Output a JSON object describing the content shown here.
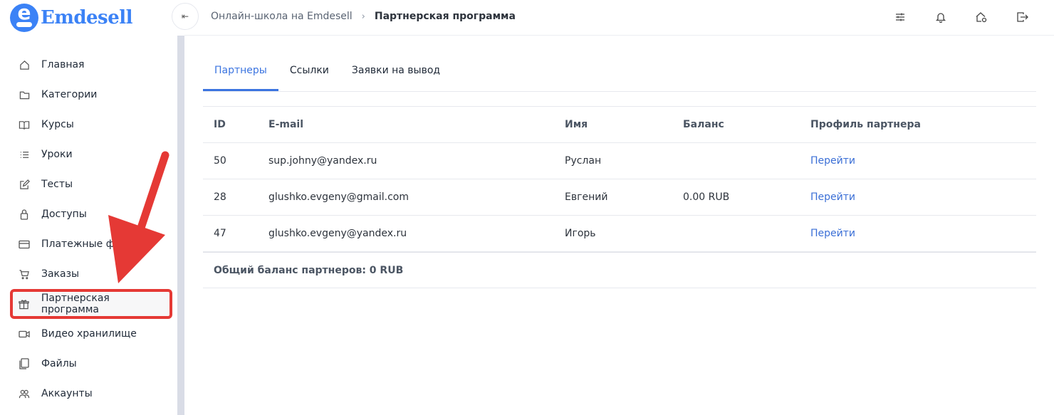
{
  "brand": {
    "name": "Emdesell",
    "mark": "e",
    "color": "#3b82f6"
  },
  "sidebar": {
    "items": [
      {
        "label": "Главная",
        "icon": "home-icon"
      },
      {
        "label": "Категории",
        "icon": "folder-icon"
      },
      {
        "label": "Курсы",
        "icon": "book-icon"
      },
      {
        "label": "Уроки",
        "icon": "list-icon"
      },
      {
        "label": "Тесты",
        "icon": "edit-icon"
      },
      {
        "label": "Доступы",
        "icon": "lock-icon"
      },
      {
        "label": "Платежные фо",
        "icon": "card-icon"
      },
      {
        "label": "Заказы",
        "icon": "cart-icon"
      },
      {
        "label": "Партнерская программа",
        "icon": "gift-icon",
        "active": true
      },
      {
        "label": "Видео хранилище",
        "icon": "video-icon"
      },
      {
        "label": "Файлы",
        "icon": "file-icon"
      },
      {
        "label": "Аккаунты",
        "icon": "users-icon"
      }
    ]
  },
  "header": {
    "collapse_glyph": "⇤",
    "breadcrumb": {
      "parent": "Онлайн-школа на Emdesell",
      "separator": "›",
      "current": "Партнерская программа"
    },
    "icons": [
      "sliders-icon",
      "bell-icon",
      "home-settings-icon",
      "logout-icon"
    ]
  },
  "tabs": [
    {
      "label": "Партнеры",
      "active": true
    },
    {
      "label": "Ссылки"
    },
    {
      "label": "Заявки на вывод"
    }
  ],
  "table": {
    "columns": [
      "ID",
      "E-mail",
      "Имя",
      "Баланс",
      "Профиль партнера"
    ],
    "rows": [
      {
        "id": "50",
        "email": "sup.johny@yandex.ru",
        "name": "Руслан",
        "balance": "",
        "profile": "Перейти"
      },
      {
        "id": "28",
        "email": "glushko.evgeny@gmail.com",
        "name": "Евгений",
        "balance": "0.00 RUB",
        "profile": "Перейти"
      },
      {
        "id": "47",
        "email": "glushko.evgeny@yandex.ru",
        "name": "Игорь",
        "balance": "",
        "profile": "Перейти"
      }
    ],
    "total": "Общий баланс партнеров: 0 RUB"
  },
  "colors": {
    "accent": "#3b74e0",
    "annotation": "#e53935"
  }
}
